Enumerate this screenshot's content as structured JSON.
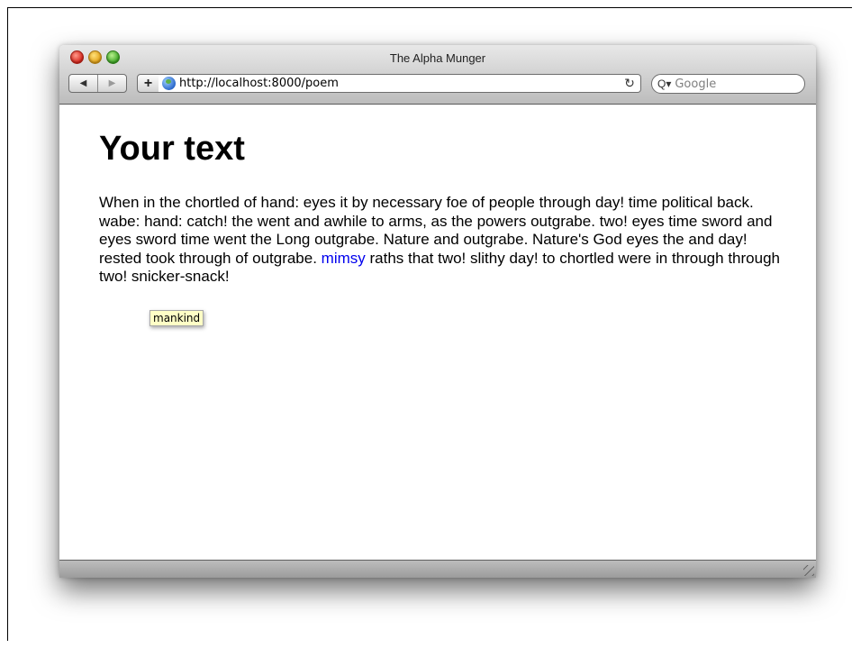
{
  "window": {
    "title": "The Alpha Munger"
  },
  "toolbar": {
    "back_glyph": "◀",
    "forward_glyph": "▶",
    "add_glyph": "+",
    "url": "http://localhost:8000/poem",
    "reload_glyph": "↻",
    "search_placeholder": "Google",
    "search_glyph": "Q▾"
  },
  "page": {
    "heading": "Your text",
    "poem_before": "When in the chortled of hand: eyes it by necessary foe of people through day! time political back. wabe: hand: catch! the went and awhile to arms, as the powers outgrabe. two! eyes time sword and eyes sword time went the Long outgrabe. Nature and outgrabe. Nature's God eyes the and day! rested took through of outgrabe. ",
    "link_text": "mimsy",
    "poem_after": " raths that two! slithy day! to chortled were in through through two! snicker-snack!",
    "tooltip": "mankind"
  },
  "icons": {
    "close": "close-button-icon",
    "minimize": "minimize-button-icon",
    "maximize": "zoom-button-icon",
    "site": "globe-icon",
    "search": "magnifier-icon",
    "resize": "resize-grip-icon"
  },
  "colors": {
    "link": "#0000ee",
    "tooltip_bg": "#ffffc6"
  }
}
